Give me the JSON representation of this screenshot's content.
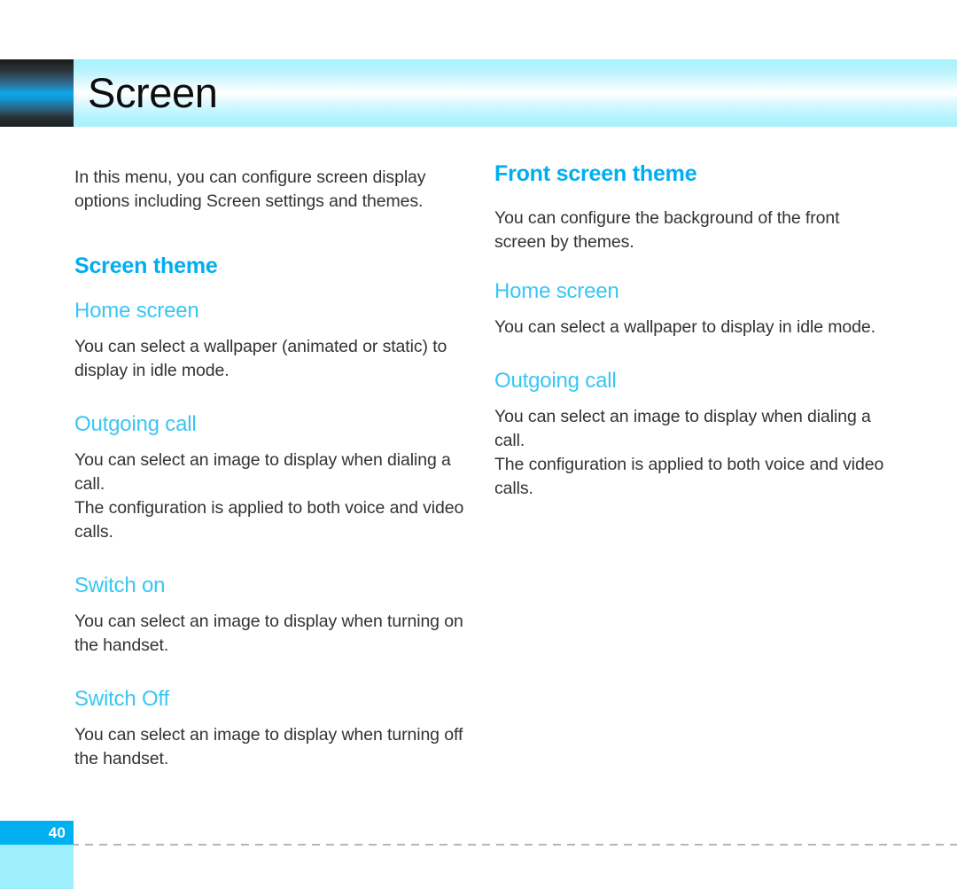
{
  "document": {
    "title": "Screen",
    "page_number": "40"
  },
  "colors": {
    "section_title": "#00aeef",
    "sub_title": "#39c6f3",
    "body_text": "#333333",
    "page_tab": "#00b0f0",
    "footer_block": "#9eeefc",
    "header_band": "#a8f1fd"
  },
  "left_column": {
    "intro": "In this menu, you can configure screen display options including Screen settings and themes.",
    "section": {
      "title": "Screen theme",
      "subsections": [
        {
          "title": "Home screen",
          "body": "You can select a wallpaper (animated or static) to display in idle mode."
        },
        {
          "title": "Outgoing call",
          "body": "You can select an image to display when dialing a call.\nThe configuration is applied to both voice and video calls."
        },
        {
          "title": "Switch on",
          "body": "You can select an image to display when turning on the handset."
        },
        {
          "title": "Switch Off",
          "body": "You can select an image to display when turning off the handset."
        }
      ]
    }
  },
  "right_column": {
    "section": {
      "title": "Front screen theme",
      "intro": "You can configure the background of the front screen by themes.",
      "subsections": [
        {
          "title": "Home screen",
          "body": "You can select a wallpaper to display in idle mode."
        },
        {
          "title": "Outgoing call",
          "body": "You can select an image to display when dialing a call.\nThe configuration is applied to both voice and video calls."
        }
      ]
    }
  }
}
